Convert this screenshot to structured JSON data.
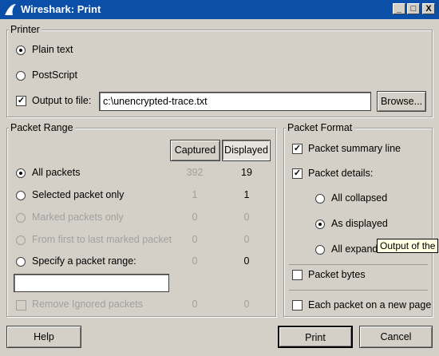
{
  "window": {
    "title": "Wireshark: Print",
    "min": "_",
    "max": "□",
    "close": "X"
  },
  "printer": {
    "legend": "Printer",
    "plain_text": "Plain text",
    "postscript": "PostScript",
    "output_to_file": "Output to file:",
    "file_value": "c:\\unencrypted-trace.txt",
    "browse": "Browse..."
  },
  "range": {
    "legend": "Packet Range",
    "captured": "Captured",
    "displayed": "Displayed",
    "rows": [
      {
        "label": "All packets",
        "captured": "392",
        "displayed": "19"
      },
      {
        "label": "Selected packet only",
        "captured": "1",
        "displayed": "1"
      },
      {
        "label": "Marked packets only",
        "captured": "0",
        "displayed": "0"
      },
      {
        "label": "From first to last marked packet",
        "captured": "0",
        "displayed": "0"
      },
      {
        "label": "Specify a packet range:",
        "captured": "0",
        "displayed": "0"
      }
    ],
    "range_input": "",
    "remove_ignored": "Remove Ignored packets",
    "remove_captured": "0",
    "remove_displayed": "0"
  },
  "format": {
    "legend": "Packet Format",
    "summary_line": "Packet summary line",
    "details": "Packet details:",
    "all_collapsed": "All collapsed",
    "as_displayed": "As displayed",
    "all_expanded": "All expande",
    "bytes": "Packet bytes",
    "new_page": "Each packet on a new page"
  },
  "tooltip": "Output of the",
  "buttons": {
    "help": "Help",
    "print": "Print",
    "cancel": "Cancel"
  }
}
